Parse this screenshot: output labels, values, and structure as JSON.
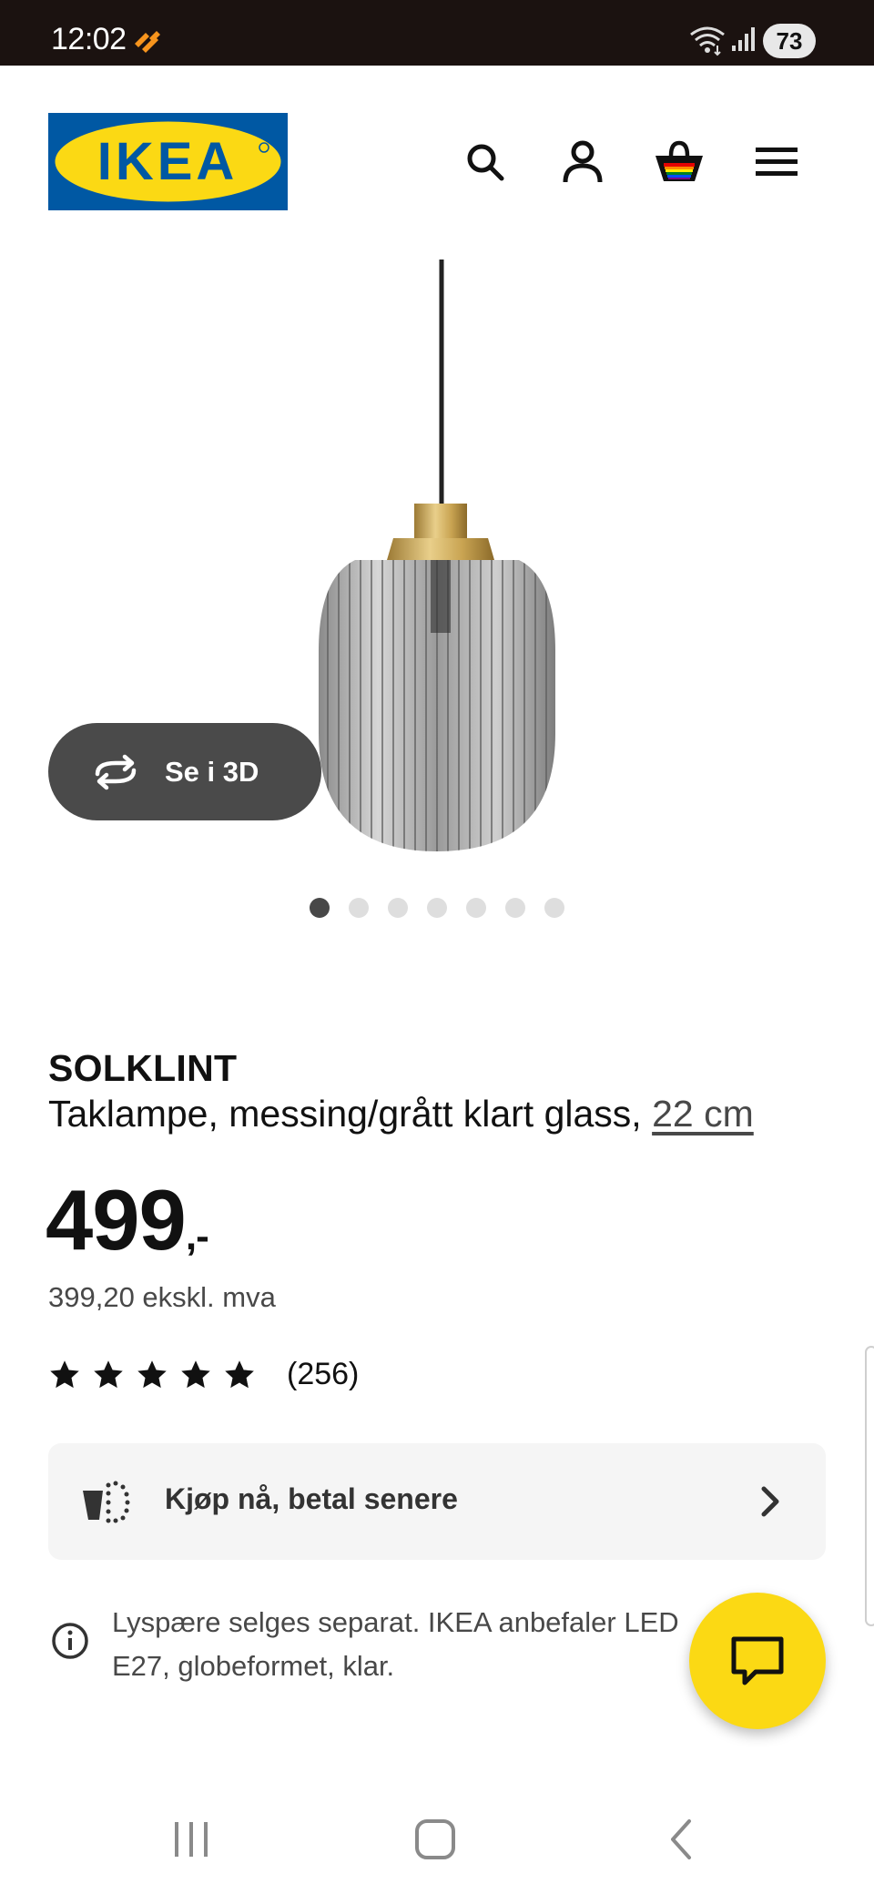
{
  "status_bar": {
    "time": "12:02",
    "battery": "73"
  },
  "header": {
    "logo_text": "IKEA",
    "colors": {
      "brand_blue": "#0058a3",
      "brand_yellow": "#fbd914"
    },
    "icons": [
      "search-icon",
      "account-icon",
      "cart-icon",
      "menu-icon"
    ]
  },
  "gallery": {
    "see_3d_label": "Se i 3D",
    "dots": [
      true,
      false,
      false,
      false,
      false,
      false,
      false
    ]
  },
  "product": {
    "name": "SOLKLINT",
    "description": "Taklampe, messing/grått klart glass,",
    "size_link": "22 cm",
    "price": "499",
    "price_suffix": ",-",
    "price_excl_vat": "399,20 ekskl. mva",
    "rating_value": 4.5,
    "rating_count": "(256)"
  },
  "payment": {
    "label": "Kjøp nå, betal senere"
  },
  "info": {
    "text": "Lyspære selges separat. IKEA anbefaler LED E27, globeformet, klar."
  }
}
